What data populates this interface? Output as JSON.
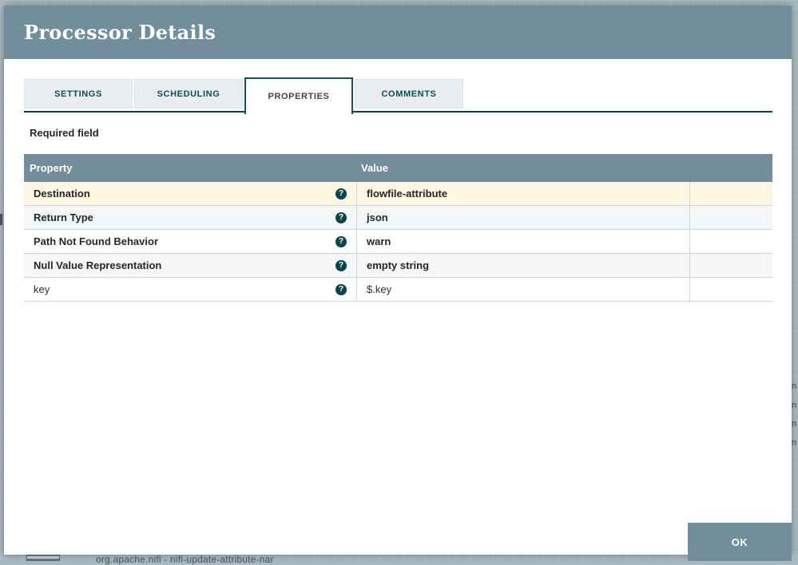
{
  "dialog": {
    "title": "Processor Details",
    "ok_label": "OK"
  },
  "tabs": [
    {
      "label": "SETTINGS",
      "active": false
    },
    {
      "label": "SCHEDULING",
      "active": false
    },
    {
      "label": "PROPERTIES",
      "active": true
    },
    {
      "label": "COMMENTS",
      "active": false
    }
  ],
  "properties_tab": {
    "required_field_label": "Required field",
    "table": {
      "columns": [
        "Property",
        "Value"
      ],
      "rows": [
        {
          "property": "Destination",
          "value": "flowfile-attribute"
        },
        {
          "property": "Return Type",
          "value": "json"
        },
        {
          "property": "Path Not Found Behavior",
          "value": "warn"
        },
        {
          "property": "Null Value Representation",
          "value": "empty string"
        },
        {
          "property": "key",
          "value": "$.key"
        }
      ]
    }
  },
  "icons": {
    "help": "?"
  },
  "background": {
    "processor_subtitle": "org.apache.nifi - nifi-update-attribute-nar",
    "edge_fragments": [
      "n",
      "n",
      "n",
      "n"
    ]
  },
  "colors": {
    "header_slate": "#728e9b",
    "accent_teal": "#07515a",
    "tab_border_teal": "#0b5460",
    "selected_row_yellow": "#fdf7e1",
    "alt_row_gray": "#f4f6f7",
    "canvas_backdrop": "#a9bbc2"
  }
}
